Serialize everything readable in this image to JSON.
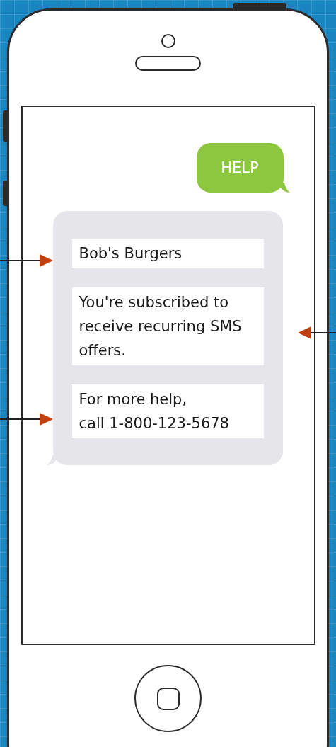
{
  "messages": [
    {
      "kind": "sent",
      "text": "HELP"
    },
    {
      "kind": "received",
      "parts": [
        "Bob's Burgers",
        "You're subscribed to receive recurring SMS offers.",
        "For more help,\ncall 1-800-123-5678"
      ]
    }
  ]
}
